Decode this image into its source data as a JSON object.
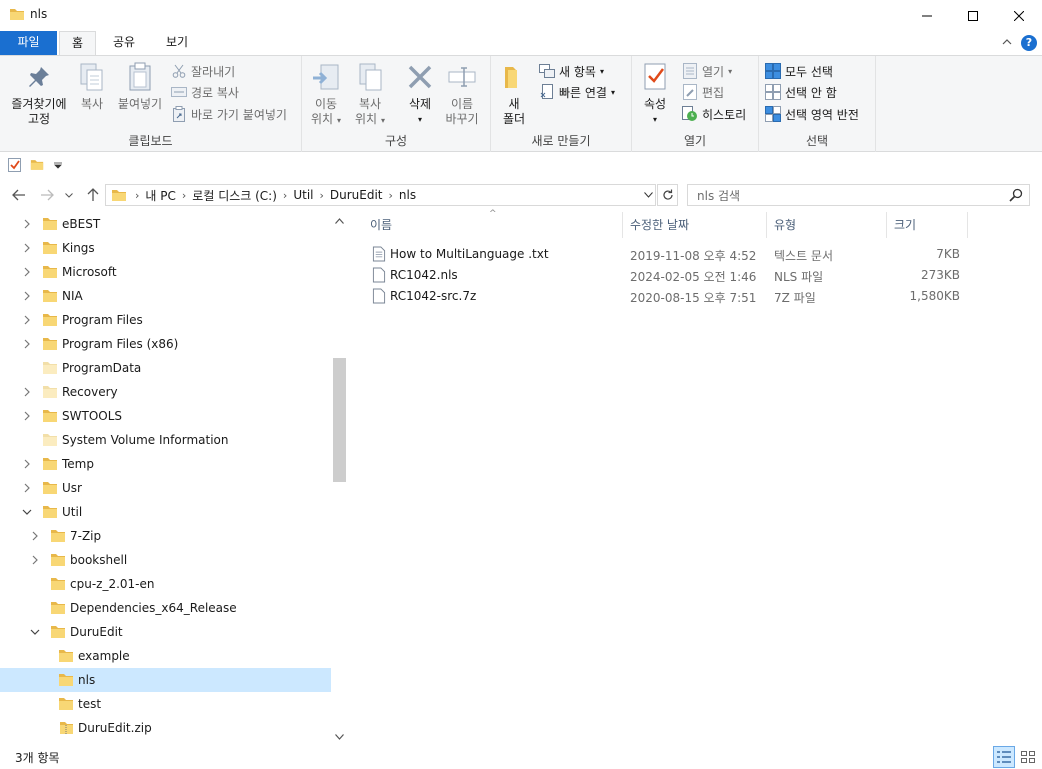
{
  "window": {
    "title": "nls"
  },
  "ribbon_tabs": [
    {
      "label": "파일"
    },
    {
      "label": "홈"
    },
    {
      "label": "공유"
    },
    {
      "label": "보기"
    }
  ],
  "ribbon": {
    "clipboard": {
      "label": "클립보드",
      "pin_line1": "즐겨찾기에",
      "pin_line2": "고정",
      "copy": "복사",
      "paste": "붙여넣기",
      "cut": "잘라내기",
      "copy_path": "경로 복사",
      "paste_shortcut": "바로 가기 붙여넣기"
    },
    "organize": {
      "label": "구성",
      "move_line1": "이동",
      "move_line2": "위치",
      "copyto_line1": "복사",
      "copyto_line2": "위치",
      "delete": "삭제",
      "rename_line1": "이름",
      "rename_line2": "바꾸기"
    },
    "new": {
      "label": "새로 만들기",
      "folder_line1": "새",
      "folder_line2": "폴더",
      "new_item": "새 항목",
      "easy_access": "빠른 연결"
    },
    "open": {
      "label": "열기",
      "properties": "속성",
      "open": "열기",
      "edit": "편집",
      "history": "히스토리"
    },
    "select": {
      "label": "선택",
      "select_all": "모두 선택",
      "select_none": "선택 안 함",
      "invert": "선택 영역 반전"
    }
  },
  "address": {
    "crumbs": [
      "내 PC",
      "로컬 디스크 (C:)",
      "Util",
      "DuruEdit",
      "nls"
    ],
    "search_placeholder": "nls 검색"
  },
  "tree": [
    {
      "label": "eBEST",
      "level": 0,
      "expander": "collapsed",
      "icon": "folder"
    },
    {
      "label": "Kings",
      "level": 0,
      "expander": "collapsed",
      "icon": "folder"
    },
    {
      "label": "Microsoft",
      "level": 0,
      "expander": "collapsed",
      "icon": "folder"
    },
    {
      "label": "NIA",
      "level": 0,
      "expander": "collapsed",
      "icon": "folder"
    },
    {
      "label": "Program Files",
      "level": 0,
      "expander": "collapsed",
      "icon": "folder"
    },
    {
      "label": "Program Files (x86)",
      "level": 0,
      "expander": "collapsed",
      "icon": "folder"
    },
    {
      "label": "ProgramData",
      "level": 0,
      "expander": "none",
      "icon": "folder-faded"
    },
    {
      "label": "Recovery",
      "level": 0,
      "expander": "collapsed",
      "icon": "folder-faded"
    },
    {
      "label": "SWTOOLS",
      "level": 0,
      "expander": "collapsed",
      "icon": "folder"
    },
    {
      "label": "System Volume Information",
      "level": 0,
      "expander": "none",
      "icon": "folder-faded"
    },
    {
      "label": "Temp",
      "level": 0,
      "expander": "collapsed",
      "icon": "folder"
    },
    {
      "label": "Usr",
      "level": 0,
      "expander": "collapsed",
      "icon": "folder"
    },
    {
      "label": "Util",
      "level": 0,
      "expander": "expanded",
      "icon": "folder"
    },
    {
      "label": "7-Zip",
      "level": 1,
      "expander": "collapsed",
      "icon": "folder"
    },
    {
      "label": "bookshell",
      "level": 1,
      "expander": "collapsed",
      "icon": "folder"
    },
    {
      "label": "cpu-z_2.01-en",
      "level": 1,
      "expander": "none",
      "icon": "folder"
    },
    {
      "label": "Dependencies_x64_Release",
      "level": 1,
      "expander": "none",
      "icon": "folder"
    },
    {
      "label": "DuruEdit",
      "level": 1,
      "expander": "expanded",
      "icon": "folder"
    },
    {
      "label": "example",
      "level": 2,
      "expander": "none",
      "icon": "folder"
    },
    {
      "label": "nls",
      "level": 2,
      "expander": "none",
      "icon": "folder",
      "selected": true
    },
    {
      "label": "test",
      "level": 2,
      "expander": "none",
      "icon": "folder"
    },
    {
      "label": "DuruEdit.zip",
      "level": 2,
      "expander": "none",
      "icon": "zip"
    }
  ],
  "columns": {
    "name": "이름",
    "date": "수정한 날짜",
    "type": "유형",
    "size": "크기"
  },
  "files": [
    {
      "name": "How to MultiLanguage .txt",
      "date": "2019-11-08 오후 4:52",
      "type": "텍스트 문서",
      "size": "7KB",
      "icon": "text-file"
    },
    {
      "name": "RC1042.nls",
      "date": "2024-02-05 오전 1:46",
      "type": "NLS 파일",
      "size": "273KB",
      "icon": "blank-file"
    },
    {
      "name": "RC1042-src.7z",
      "date": "2020-08-15 오후 7:51",
      "type": "7Z 파일",
      "size": "1,580KB",
      "icon": "blank-file"
    }
  ],
  "status": {
    "item_count": "3개 항목"
  },
  "colors": {
    "accent": "#1a6fd0",
    "selection": "#cce8ff",
    "folder": "#f8d775",
    "folder_dark": "#e8b84a"
  }
}
